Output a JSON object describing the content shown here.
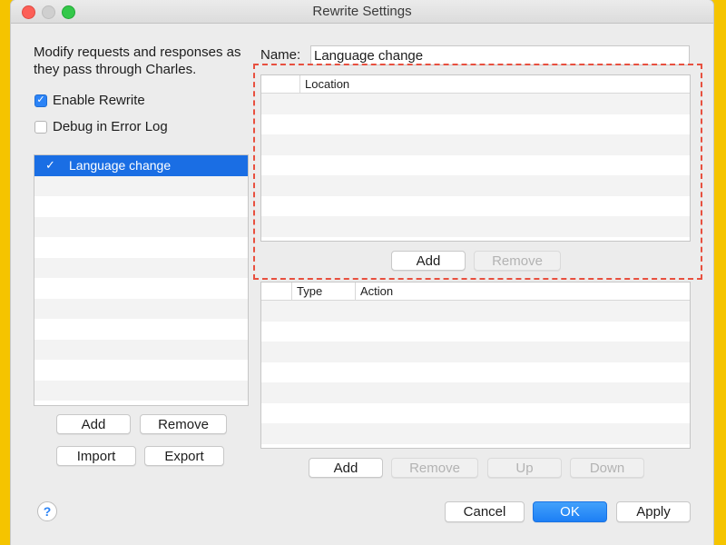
{
  "window": {
    "title": "Rewrite Settings"
  },
  "left": {
    "description": "Modify requests and responses as they pass through Charles.",
    "enable_rewrite": {
      "label": "Enable Rewrite",
      "checked": true
    },
    "debug_log": {
      "label": "Debug in Error Log",
      "checked": false
    },
    "sets": [
      {
        "label": "Language change",
        "checked": true,
        "selected": true
      }
    ],
    "buttons": {
      "add": "Add",
      "remove": "Remove",
      "import": "Import",
      "export": "Export"
    }
  },
  "right": {
    "name_label": "Name:",
    "name_value": "Language change",
    "locations": {
      "header_location": "Location",
      "add": "Add",
      "remove": "Remove"
    },
    "rules": {
      "header_type": "Type",
      "header_action": "Action",
      "add": "Add",
      "remove": "Remove",
      "up": "Up",
      "down": "Down"
    }
  },
  "footer": {
    "help": "?",
    "cancel": "Cancel",
    "ok": "OK",
    "apply": "Apply"
  },
  "colors": {
    "accent": "#1a6ee4",
    "highlight": "#e8503f",
    "background": "#f5c400"
  }
}
